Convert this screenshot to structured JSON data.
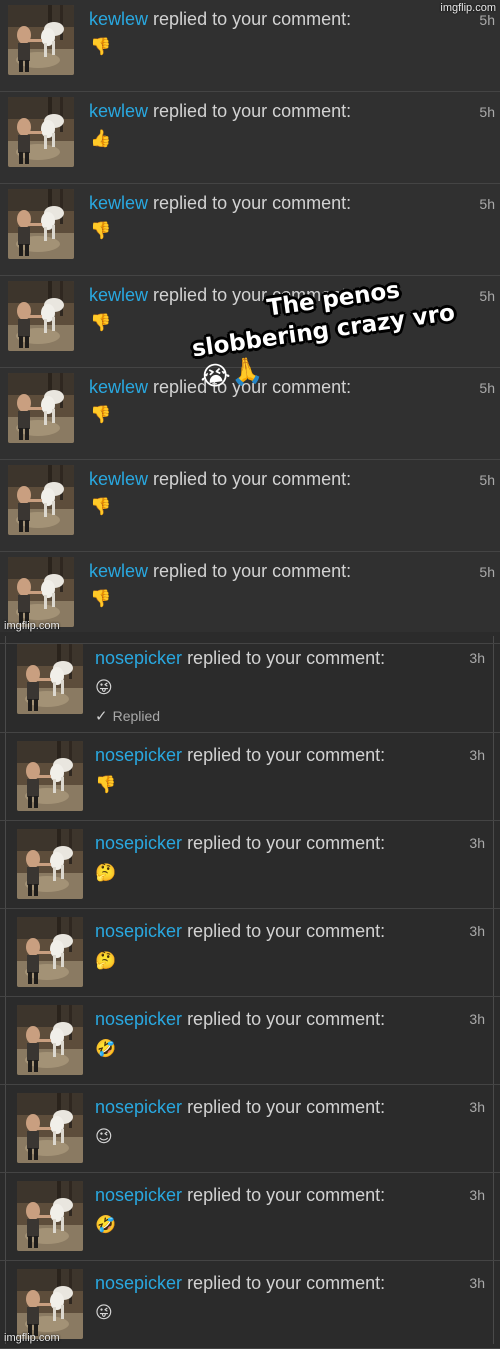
{
  "top_section": {
    "watermark": "imgflip.com",
    "notifications": [
      {
        "username": "kewlew",
        "action": "replied to your comment:",
        "time": "5h",
        "emoji": "👎",
        "emoji_name": "thumbs-down-icon"
      },
      {
        "username": "kewlew",
        "action": "replied to your comment:",
        "time": "5h",
        "emoji": "👍",
        "emoji_name": "thumbs-up-icon"
      },
      {
        "username": "kewlew",
        "action": "replied to your comment:",
        "time": "5h",
        "emoji": "👎",
        "emoji_name": "thumbs-down-icon"
      },
      {
        "username": "kewlew",
        "action": "replied to your comment:",
        "time": "5h",
        "emoji": "👎",
        "emoji_name": "thumbs-down-icon"
      },
      {
        "username": "kewlew",
        "action": "replied to your comment:",
        "time": "5h",
        "emoji": "👎",
        "emoji_name": "thumbs-down-icon"
      },
      {
        "username": "kewlew",
        "action": "replied to your comment:",
        "time": "5h",
        "emoji": "👎",
        "emoji_name": "thumbs-down-icon"
      },
      {
        "username": "kewlew",
        "action": "replied to your comment:",
        "time": "5h",
        "emoji": "👎",
        "emoji_name": "thumbs-down-icon"
      }
    ],
    "watermark_bottom": "imgflip.com"
  },
  "caption": {
    "line1": "The penos",
    "line2": "slobbering crazy vro",
    "emojis": "😭🙏"
  },
  "bottom_section": {
    "watermark": "imgflip.com",
    "notifications": [
      {
        "username": "nosepicker",
        "action": "replied to your comment:",
        "time": "3h",
        "emoji": "😜",
        "emoji_name": "winking-tongue-face-icon",
        "replied_label": "Replied"
      },
      {
        "username": "nosepicker",
        "action": "replied to your comment:",
        "time": "3h",
        "emoji": "👎",
        "emoji_name": "thumbs-down-icon"
      },
      {
        "username": "nosepicker",
        "action": "replied to your comment:",
        "time": "3h",
        "emoji": "🤔",
        "emoji_name": "thinking-face-icon"
      },
      {
        "username": "nosepicker",
        "action": "replied to your comment:",
        "time": "3h",
        "emoji": "🤔",
        "emoji_name": "thinking-face-icon"
      },
      {
        "username": "nosepicker",
        "action": "replied to your comment:",
        "time": "3h",
        "emoji": "🤣",
        "emoji_name": "rofl-face-icon"
      },
      {
        "username": "nosepicker",
        "action": "replied to your comment:",
        "time": "3h",
        "emoji": "😉",
        "emoji_name": "winking-face-icon"
      },
      {
        "username": "nosepicker",
        "action": "replied to your comment:",
        "time": "3h",
        "emoji": "🤣",
        "emoji_name": "rofl-face-icon"
      },
      {
        "username": "nosepicker",
        "action": "replied to your comment:",
        "time": "3h",
        "emoji": "😜",
        "emoji_name": "winking-tongue-face-icon"
      }
    ]
  },
  "colors": {
    "username": "#29a8e0",
    "text": "#d2d2d2",
    "background": "#303030",
    "divider": "#444444"
  }
}
